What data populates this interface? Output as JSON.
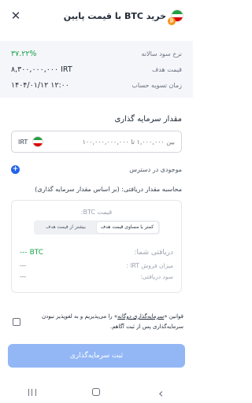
{
  "header": {
    "title": "خرید BTC با قیمت پایین",
    "close_icon": "close-icon",
    "btc_badge": "₿"
  },
  "info": {
    "rows": [
      {
        "label": "نرخ سود سالانه",
        "value": "۳۷.۲۲%",
        "color": "#16a34a"
      },
      {
        "label": "قیمت هدف",
        "value": "۸,۳۰۰,۰۰۰,۰۰۰ IRT"
      },
      {
        "label": "زمان تسویه حساب",
        "value": "۱۴۰۴/۰۱/۱۲ ۱۲:۰۰"
      }
    ]
  },
  "investment": {
    "title": "مقدار سرمایه گذاری",
    "currency": "IRT",
    "placeholder": "بین ۱,۰۰۰,۰۰۰ تا ۱۰۰,۰۰۰,۰۰۰,۰۰۰"
  },
  "available": {
    "label": "موجودی در دسترس",
    "plus_icon": "+"
  },
  "calculation": {
    "title": "محاسبه مقدار دریافتی: (بر اساس مقدار سرمایه گذاری)",
    "target_price_label": "قیمت BTC:",
    "segments": [
      {
        "label": "کمتر یا مساوی قیمت هدف",
        "active": true
      },
      {
        "label": "بیشتر از قیمت هدف",
        "active": false
      }
    ],
    "received_label": "دریافتی شما:",
    "received_value": "--- BTC",
    "sell_price_label": "میزان فروش IRT :",
    "sell_price_value": "---",
    "profit_label": "سود دریافتی:",
    "profit_value": "---"
  },
  "terms": {
    "prefix": "قوانین «",
    "link": "سرمایه‌گذاری دوگانه",
    "suffix": "» را می‌پذیریم و به لغوپذیر نبودن سرمایه‌گذاری پس از ثبت آگاهم."
  },
  "submit": {
    "label": "ثبت سرمایه‌گذاری"
  },
  "navbar": {
    "back_glyph": "‹"
  },
  "colors": {
    "accent": "#2563eb",
    "disabled_button": "#93b7f5",
    "positive": "#16a34a"
  }
}
